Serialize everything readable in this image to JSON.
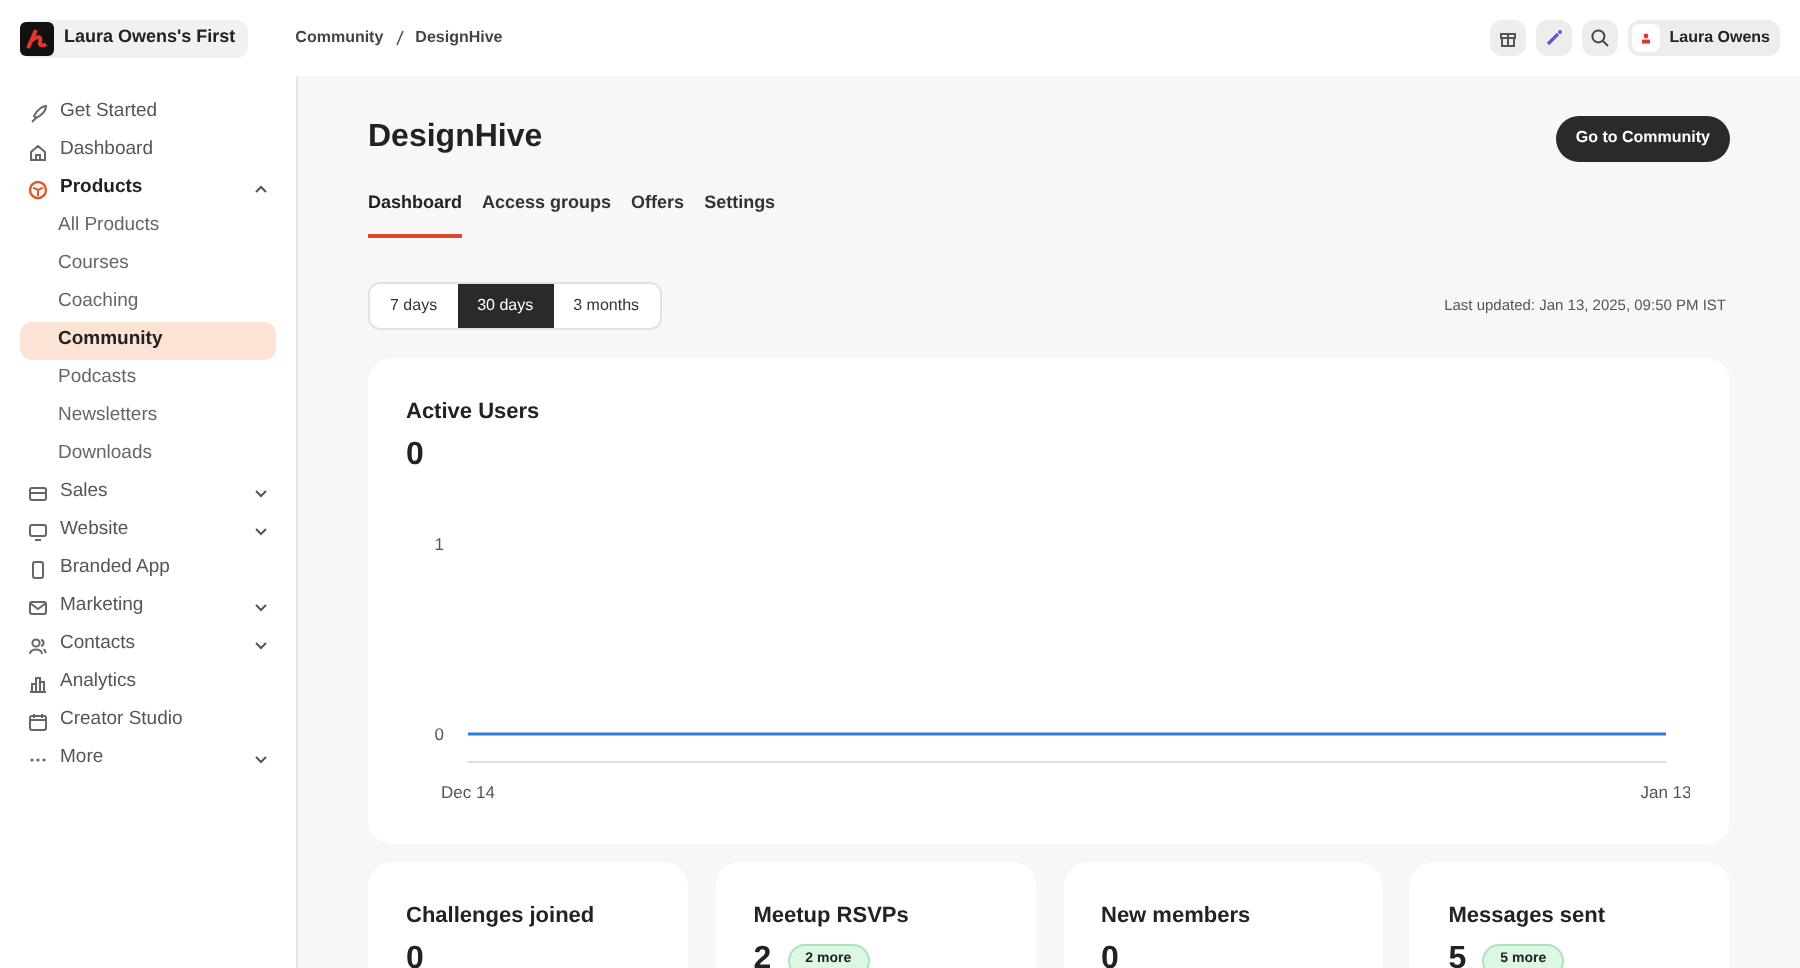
{
  "header": {
    "workspace": "Laura Owens's First",
    "breadcrumb": [
      "Community",
      "DesignHive"
    ],
    "user": "Laura Owens"
  },
  "sidebar": {
    "items": [
      {
        "label": "Get Started",
        "selected": false
      },
      {
        "label": "Dashboard",
        "selected": false
      },
      {
        "label": "Products",
        "selected": false,
        "expanded": true,
        "children": [
          {
            "label": "All Products",
            "selected": false
          },
          {
            "label": "Courses",
            "selected": false
          },
          {
            "label": "Coaching",
            "selected": false
          },
          {
            "label": "Community",
            "selected": true
          },
          {
            "label": "Podcasts",
            "selected": false
          },
          {
            "label": "Newsletters",
            "selected": false
          },
          {
            "label": "Downloads",
            "selected": false
          }
        ]
      },
      {
        "label": "Sales",
        "selected": false,
        "expanded": false
      },
      {
        "label": "Website",
        "selected": false,
        "expanded": false
      },
      {
        "label": "Branded App",
        "selected": false
      },
      {
        "label": "Marketing",
        "selected": false,
        "expanded": false
      },
      {
        "label": "Contacts",
        "selected": false,
        "expanded": false
      },
      {
        "label": "Analytics",
        "selected": false
      },
      {
        "label": "Creator Studio",
        "selected": false
      },
      {
        "label": "More",
        "selected": false,
        "expanded": false
      }
    ]
  },
  "page": {
    "title": "DesignHive",
    "action": "Go to Community",
    "tabs": [
      {
        "label": "Dashboard",
        "selected": true
      },
      {
        "label": "Access groups",
        "selected": false
      },
      {
        "label": "Offers",
        "selected": false
      },
      {
        "label": "Settings",
        "selected": false
      }
    ],
    "ranges": [
      {
        "label": "7 days",
        "selected": false
      },
      {
        "label": "30 days",
        "selected": true
      },
      {
        "label": "3 months",
        "selected": false
      }
    ],
    "last_updated": "Last updated: Jan 13, 2025, 09:50 PM IST",
    "active_users": {
      "title": "Active Users",
      "value": "0",
      "chart_data": {
        "type": "line",
        "categories": [
          "Dec 14",
          "Jan 13"
        ],
        "series": [
          {
            "color": "#2f7fd0",
            "values": [
              0,
              0
            ]
          }
        ],
        "ylim": [
          0,
          1
        ],
        "yticks": [
          0,
          1
        ]
      }
    },
    "stats": [
      {
        "title": "Challenges joined",
        "value": "0"
      },
      {
        "title": "Meetup RSVPs",
        "value": "2",
        "badge": "2 more"
      },
      {
        "title": "New members",
        "value": "0"
      },
      {
        "title": "Messages sent",
        "value": "5",
        "badge": "5 more"
      }
    ]
  }
}
